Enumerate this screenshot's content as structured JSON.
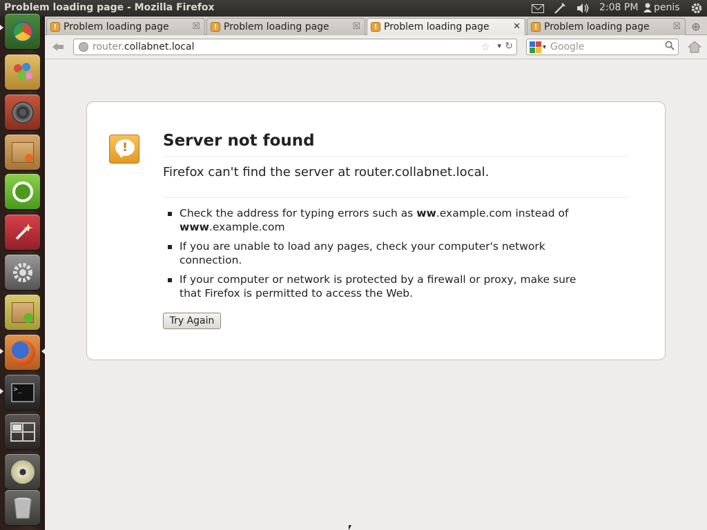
{
  "window": {
    "title": "Problem loading page - Mozilla Firefox"
  },
  "panel": {
    "clock": "2:08 PM",
    "username": "penis",
    "indicators": [
      "mail-icon",
      "network-icon",
      "volume-icon",
      "gear-icon"
    ]
  },
  "launcher": {
    "items": [
      "chromium-icon",
      "paint-icon",
      "speaker-icon",
      "package-archive-icon",
      "ubuntu-software-icon",
      "wand-icon",
      "system-settings-icon",
      "package-install-icon",
      "firefox-icon",
      "terminal-icon",
      "workspace-switcher-icon",
      "dvd-icon",
      "trash-icon"
    ]
  },
  "tabs": [
    {
      "label": "Problem loading page",
      "active": false
    },
    {
      "label": "Problem loading page",
      "active": false
    },
    {
      "label": "Problem loading page",
      "active": true
    },
    {
      "label": "Problem loading page",
      "active": false
    }
  ],
  "navbar": {
    "url_prefix": "router.",
    "url_host": "collabnet.local",
    "search_placeholder": "Google"
  },
  "error": {
    "title": "Server not found",
    "description": "Firefox can't find the server at router.collabnet.local.",
    "bullets": [
      {
        "pre": "Check the address for typing errors such as ",
        "bold1": "ww",
        "mid": ".example.com instead of ",
        "bold2": "www",
        "post": ".example.com"
      },
      {
        "text": "If you are unable to load any pages, check your computer's network connection."
      },
      {
        "text": "If your computer or network is protected by a firewall or proxy, make sure that Firefox is permitted to access the Web."
      }
    ],
    "button_label": "Try Again"
  }
}
